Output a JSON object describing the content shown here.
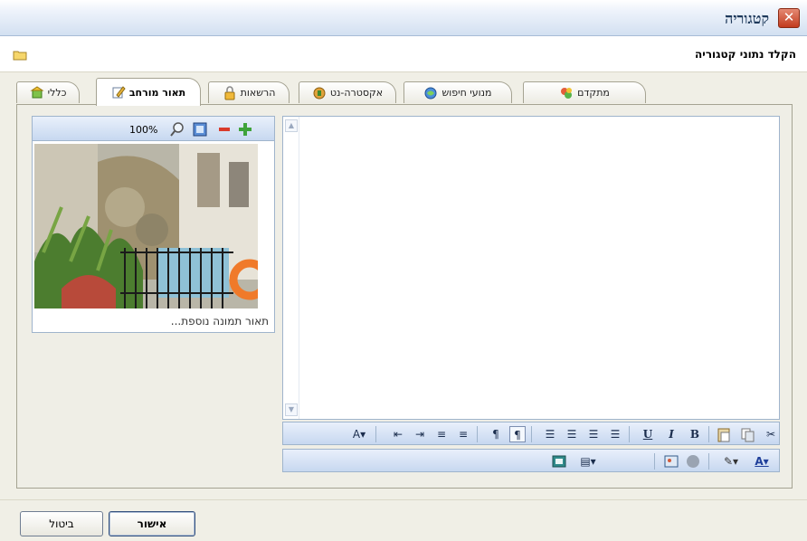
{
  "window": {
    "title": "קטגוריה",
    "close_glyph": "✕"
  },
  "header": {
    "instruction": "הקלד נתוני קטגוריה"
  },
  "tabs": [
    {
      "label": "כללי",
      "icon": "general-icon"
    },
    {
      "label": "תאור מורחב",
      "icon": "edit-icon",
      "active": true
    },
    {
      "label": "הרשאות",
      "icon": "lock-icon"
    },
    {
      "label": "אקסטרה-נט",
      "icon": "extranet-icon"
    },
    {
      "label": "מנועי חיפוש",
      "icon": "search-engine-icon"
    },
    {
      "label": "מתקדם",
      "icon": "advanced-icon"
    }
  ],
  "image_panel": {
    "zoom_level": "100%",
    "caption_placeholder": "תאור תמונה נוספת..."
  },
  "editor_toolbar": {
    "row1": [
      "cut-icon",
      "copy-icon",
      "paste-icon",
      "bold-button",
      "italic-button",
      "underline-button",
      "align-right-icon",
      "align-center-icon",
      "align-left-icon",
      "justify-icon",
      "rtl-icon",
      "ltr-icon",
      "numbered-list-icon",
      "bullet-list-icon",
      "indent-icon",
      "outdent-icon",
      "text-style-icon"
    ],
    "row2": [
      "font-color-icon",
      "highlight-icon",
      "image-icon",
      "insert-image-icon",
      "table-icon",
      "source-icon"
    ],
    "bold_label": "B",
    "italic_label": "I",
    "underline_label": "U"
  },
  "footer": {
    "ok_label": "אישור",
    "cancel_label": "ביטול"
  },
  "colors": {
    "title_blue": "#1e395b",
    "close_red": "#c23b1e",
    "toolbar_blue": "#c7d8f0",
    "panel_beige": "#efeee6"
  }
}
